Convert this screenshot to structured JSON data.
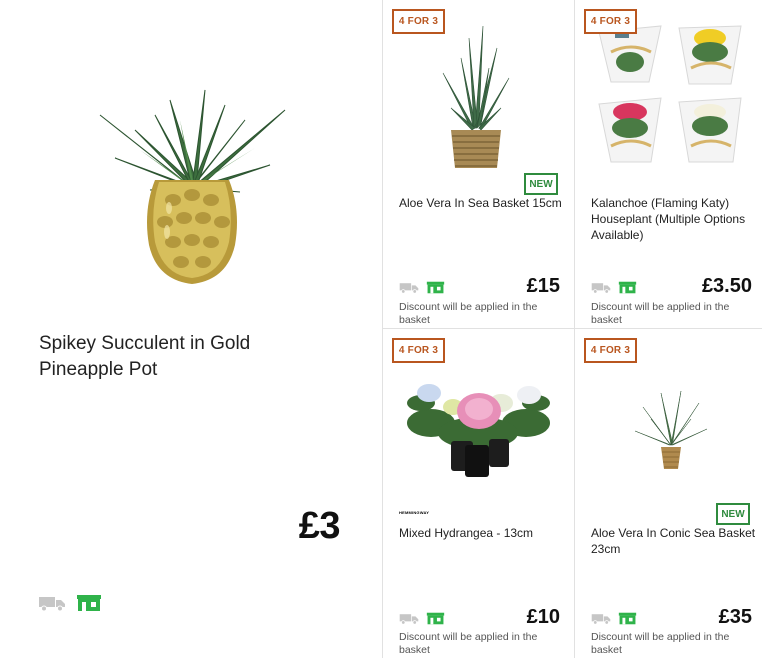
{
  "featured": {
    "title": "Spikey Succulent in Gold Pineapple Pot",
    "price": "£3",
    "icons": [
      "delivery-truck-icon",
      "store-pickup-icon"
    ]
  },
  "products": [
    {
      "badge": "4 FOR 3",
      "new_label": "NEW",
      "title": "Aloe Vera In Sea Basket 15cm",
      "price": "£15",
      "note": "Discount will be applied in the basket"
    },
    {
      "badge": "4 FOR 3",
      "title": "Kalanchoe (Flaming Katy) Houseplant (Multiple Options Available)",
      "price": "£3.50",
      "note": "Discount will be applied in the basket"
    },
    {
      "badge": "4 FOR 3",
      "brand_mark": "HEMMINGWAY",
      "title": "Mixed Hydrangea - 13cm",
      "price": "£10",
      "note": "Discount will be applied in the basket"
    },
    {
      "badge": "4 FOR 3",
      "new_label": "NEW",
      "title": "Aloe Vera In Conic Sea Basket 23cm",
      "price": "£35",
      "note": "Discount will be applied in the basket"
    }
  ],
  "colors": {
    "offer_badge": "#b9561f",
    "new_badge": "#2f8b3e",
    "store_icon": "#2fb34a",
    "truck_icon": "#c6c6c6",
    "divider": "#e1e1e1"
  }
}
